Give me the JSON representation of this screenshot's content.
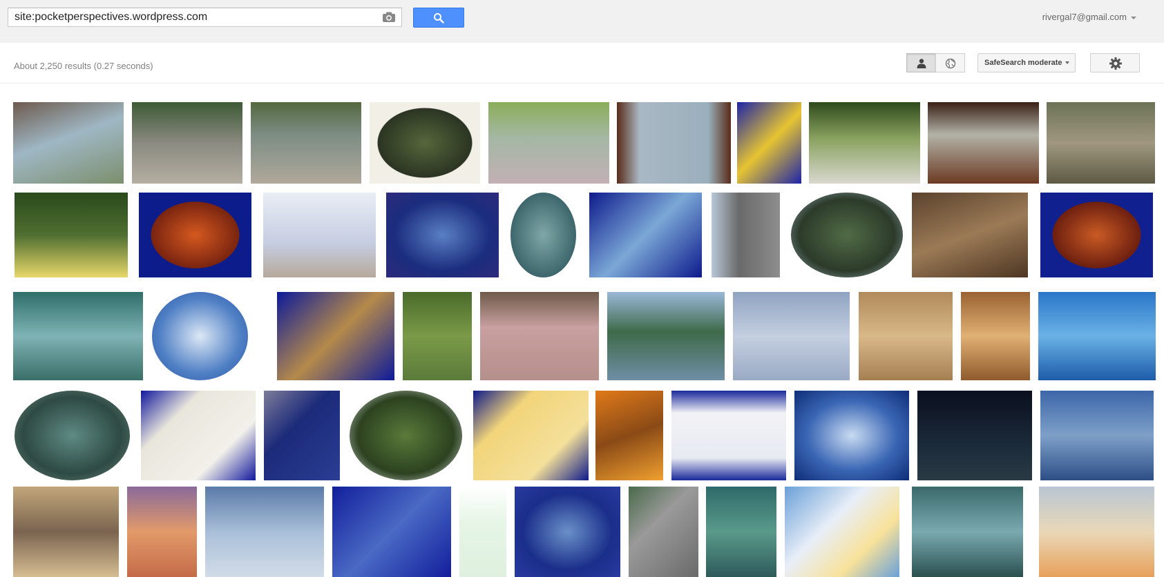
{
  "search": {
    "query": "site:pocketperspectives.wordpress.com",
    "camera_icon": "camera-icon",
    "button_icon": "magnifier-icon"
  },
  "account": {
    "email": "rivergal7@gmail.com"
  },
  "toolbar": {
    "results_stats": "About 2,250 results (0.27 seconds)",
    "safesearch_label": "SafeSearch moderate",
    "personal_icon": "person-icon",
    "world_icon": "globe-icon",
    "settings_icon": "gear-icon"
  },
  "colors": {
    "accent_blue": "#4d90fe",
    "topbar_bg": "#f1f1f1"
  },
  "results": {
    "rows": [
      [
        {
          "bg": "linear-gradient(160deg,#6d5a4e,#9fb7c4 45%,#7c8f6d)",
          "shape": "rect"
        },
        {
          "bg": "linear-gradient(180deg,#3e5a36,#8a8a80 50%,#b5aea2)",
          "shape": "rect"
        },
        {
          "bg": "linear-gradient(180deg,#55683f,#7d8d84 40%,#b0a89b)",
          "shape": "rect"
        },
        {
          "bg": "radial-gradient(ellipse at center,#56673c,#2b3422 60%,#f1efe6 61%)",
          "shape": "rect"
        },
        {
          "bg": "linear-gradient(180deg,#8cae5a,#a5b7a5 45%,#c2b0b5)",
          "shape": "rect"
        },
        {
          "bg": "linear-gradient(90deg,#5a2b19,#a9b8c4 20%,#9ab0bc 80%,#5a2b19)",
          "shape": "rect"
        },
        {
          "bg": "linear-gradient(135deg,#1d24a8,#e6c432 50%,#1d24a8)",
          "shape": "rect"
        },
        {
          "bg": "linear-gradient(180deg,#2f4a1c,#8aa260 45%,#d9d8cf)",
          "shape": "rect"
        },
        {
          "bg": "linear-gradient(180deg,#3a1f16,#b3b3a8 40%,#6b3a22)",
          "shape": "rect"
        },
        {
          "bg": "linear-gradient(180deg,#6c7256,#a09880 50%,#5d5a45)",
          "shape": "rect"
        }
      ],
      [
        {
          "bg": "linear-gradient(180deg,#2a4a1c,#4f6e30 50%,#e7d86a)",
          "shape": "rect"
        },
        {
          "bg": "radial-gradient(ellipse at center,#d5591f,#7a2410 55%,#0c1c8a 56%)",
          "shape": "rect"
        },
        {
          "bg": "linear-gradient(180deg,#e9edf5,#c5cde1 60%,#b7a99a)",
          "shape": "rect"
        },
        {
          "bg": "radial-gradient(ellipse at center,#5a7fc4,#1b2d7e 60%,#2d2a7c)",
          "shape": "rect"
        },
        {
          "bg": "radial-gradient(ellipse at center,#7fa7a9,#214b52)",
          "shape": "oval"
        },
        {
          "bg": "linear-gradient(135deg,#0e1a8c,#7aa8d6 50%,#0e1a8c)",
          "shape": "rect"
        },
        {
          "bg": "linear-gradient(90deg,#b8c7d8,#6a6a6a 40%,#8d8d8d)",
          "shape": "rect"
        },
        {
          "bg": "radial-gradient(ellipse at center,#516b46,#2c3b2a 60%,#9ab0c0)",
          "shape": "oval"
        },
        {
          "bg": "linear-gradient(160deg,#5b432e,#9b7a56 50%,#4d3623)",
          "shape": "rect"
        },
        {
          "bg": "radial-gradient(ellipse at center,#c95b24,#6e1f10 55%,#10208f 56%)",
          "shape": "rect"
        }
      ],
      [
        {
          "bg": "linear-gradient(180deg,#2f6f6a,#7fb3b5 50%,#3a6e68)",
          "shape": "rect"
        },
        {
          "bg": "radial-gradient(ellipse at center,#dce8f6,#4f7fc4 60%,#2c57a8)",
          "shape": "oval"
        },
        {
          "bg": "linear-gradient(135deg,#0d1a9a,#b58a4a 50%,#0d1a9a)",
          "shape": "rect"
        },
        {
          "bg": "linear-gradient(180deg,#4a6b2a,#7a9a48 50%,#5c7a3a)",
          "shape": "rect"
        },
        {
          "bg": "linear-gradient(180deg,#6e5a4a,#c8a0a0 40%,#b58f8a)",
          "shape": "rect"
        },
        {
          "bg": "linear-gradient(180deg,#9ab8d8,#3f6a4a 45%,#6f8ea4)",
          "shape": "rect"
        },
        {
          "bg": "linear-gradient(180deg,#8fa3c2,#c4cfe0 50%,#9aaac4)",
          "shape": "rect"
        },
        {
          "bg": "linear-gradient(180deg,#b08a5a,#d9b888 50%,#a57f52)",
          "shape": "rect"
        },
        {
          "bg": "linear-gradient(180deg,#9a6232,#e1b074 50%,#8f5a2c)",
          "shape": "rect"
        },
        {
          "bg": "linear-gradient(180deg,#2b76c9,#6ab2e6 50%,#1d5ba8)",
          "shape": "rect"
        }
      ],
      [
        {
          "bg": "radial-gradient(ellipse at center,#5f8a84,#2e4a44 60%,#6c8a7c)",
          "shape": "oval"
        },
        {
          "bg": "linear-gradient(135deg,#12189c,#e9e6dc 30%,#f2f0ea 70%,#12189c)",
          "shape": "rect"
        },
        {
          "bg": "linear-gradient(135deg,#7d7d9a,#1c2a7a 40%,#2a3e94)",
          "shape": "rect"
        },
        {
          "bg": "radial-gradient(ellipse at center,#5a7a3a,#2c4220 60%,#e9ecef)",
          "shape": "oval"
        },
        {
          "bg": "linear-gradient(135deg,#0e1a8a,#f2d47a 30%,#f4e09a 70%,#0e1a8a)",
          "shape": "rect"
        },
        {
          "bg": "linear-gradient(160deg,#e07a1a,#8a4a16 50%,#f0a030)",
          "shape": "rect"
        },
        {
          "bg": "linear-gradient(180deg,#1a2a9a,#f2f2f6 25%,#e8eaf2 75%,#1a2a9a)",
          "shape": "rect"
        },
        {
          "bg": "radial-gradient(ellipse at center,#c9dbf2,#3a66b4 55%,#0f2d78)",
          "shape": "rect"
        },
        {
          "bg": "linear-gradient(180deg,#0a0f1e,#1b2a3a 60%,#2a3a44)",
          "shape": "rect"
        },
        {
          "bg": "linear-gradient(180deg,#3c66a8,#7ea0c8 50%,#2c4e86)",
          "shape": "rect"
        }
      ],
      [
        {
          "bg": "linear-gradient(180deg,#c2a67a,#7a6450 50%,#d6bd92)",
          "shape": "rect"
        },
        {
          "bg": "linear-gradient(180deg,#8a6a9a,#e29a6a 50%,#c46a48)",
          "shape": "rect"
        },
        {
          "bg": "linear-gradient(180deg,#5a7aa8,#a9bfd8 50%,#d2dce8)",
          "shape": "rect"
        },
        {
          "bg": "linear-gradient(135deg,#121e9c,#4a6ac4 50%,#121e9c)",
          "shape": "rect"
        },
        {
          "bg": "linear-gradient(180deg,#ffffff,#e6f5e6 40%,#dff0df)",
          "shape": "rect"
        },
        {
          "bg": "radial-gradient(ellipse at center,#6a90c8,#1a2e8a 60%,#2a3aa0)",
          "shape": "rect"
        },
        {
          "bg": "linear-gradient(135deg,#4a6a4a,#9a9a9a 40%,#6a6a6a)",
          "shape": "rect"
        },
        {
          "bg": "linear-gradient(180deg,#2e6a6a,#5a9a8a 50%,#2e5a5a)",
          "shape": "rect"
        },
        {
          "bg": "linear-gradient(135deg,#6aa0d8,#e8eef8 40%,#f8e29a 70%,#6aa0d8)",
          "shape": "rect"
        },
        {
          "bg": "linear-gradient(180deg,#3a6a6a,#7aaab0 50%,#2a5050)",
          "shape": "rect"
        },
        {
          "bg": "linear-gradient(180deg,#b9c6d4,#e9d8b8 50%,#e7a05a)",
          "shape": "rect"
        }
      ]
    ]
  }
}
